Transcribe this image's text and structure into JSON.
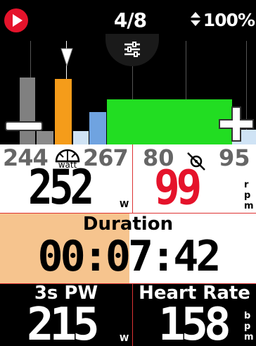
{
  "header": {
    "page_indicator": "4/8",
    "battery": "100%"
  },
  "graph": {
    "minus_label": "−",
    "plus_label": "+"
  },
  "power_field": {
    "low": "244",
    "icon_label": "watt",
    "high": "267",
    "value": "252",
    "unit": "W"
  },
  "cadence_field": {
    "low": "80",
    "high": "95",
    "value": "99",
    "unit_r": "r",
    "unit_p": "p",
    "unit_m": "m"
  },
  "duration_field": {
    "label": "Duration",
    "value": "00:07:42"
  },
  "pw3s_field": {
    "label": "3s PW",
    "value": "215",
    "unit": "W"
  },
  "hr_field": {
    "label": "Heart Rate",
    "value": "158",
    "unit_b": "b",
    "unit_p": "p",
    "unit_m": "m"
  },
  "colors": {
    "brand_red": "#e5132b",
    "zone_green": "#22dd22",
    "zone_orange": "#f59c1a",
    "zone_blue": "#6fa3e0",
    "duration_bg": "#f6c48e"
  }
}
